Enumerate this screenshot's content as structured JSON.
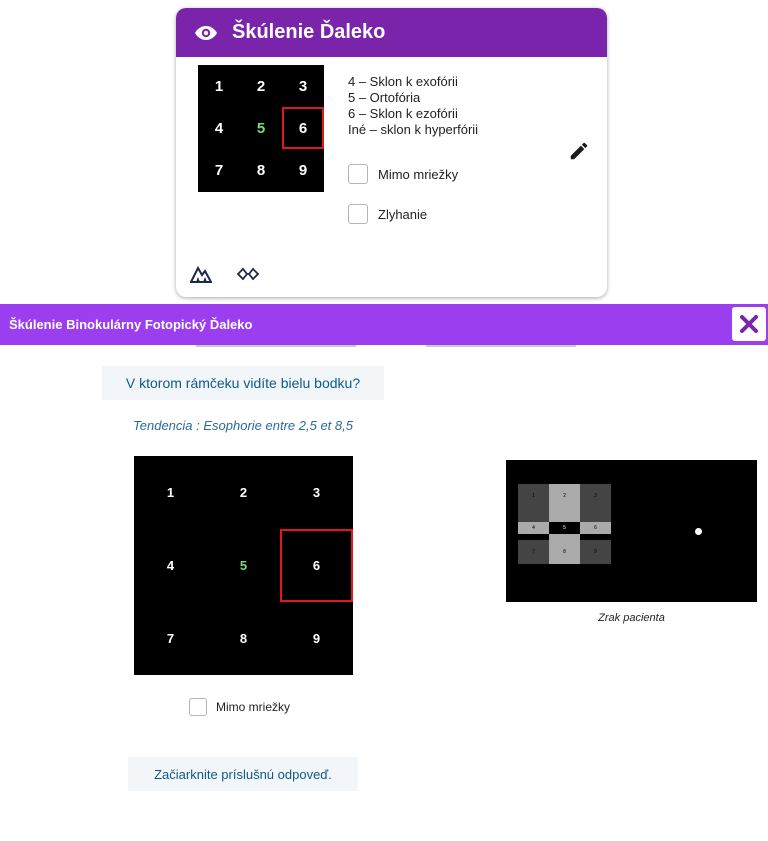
{
  "card": {
    "title": "Škúlenie Ďaleko",
    "grid": [
      "1",
      "2",
      "3",
      "4",
      "5",
      "6",
      "7",
      "8",
      "9"
    ],
    "highlight_color": "#7dd87d",
    "selected_cell": "6",
    "legend": [
      "4 – Sklon k exofórii",
      "5 – Ortofória",
      "6 – Sklon k ezofórii",
      "Iné – sklon k hyperfórii"
    ],
    "checkbox_outside": "Mimo mriežky",
    "checkbox_fail": "Zlyhanie",
    "icons": [
      "eye-icon",
      "pencil-icon",
      "mountain-icon",
      "glasses-icon"
    ]
  },
  "dialog": {
    "title": "Škúlenie Binokulárny Fotopický Ďaleko",
    "accent": "#9a3ef0",
    "question": "V ktorom rámčeku vidíte bielu bodku?",
    "tendency": "Tendencia : Esophorie entre 2,5 et 8,5",
    "grid": [
      "1",
      "2",
      "3",
      "4",
      "5",
      "6",
      "7",
      "8",
      "9"
    ],
    "selected_cell": "6",
    "checkbox_outside": "Mimo mriežky",
    "instruction": "Začiarknite príslušnú odpoveď.",
    "patient_caption": "Zrak pacienta",
    "patient_grid": [
      "1",
      "2",
      "3",
      "4",
      "5",
      "6",
      "7",
      "8",
      "9"
    ]
  }
}
